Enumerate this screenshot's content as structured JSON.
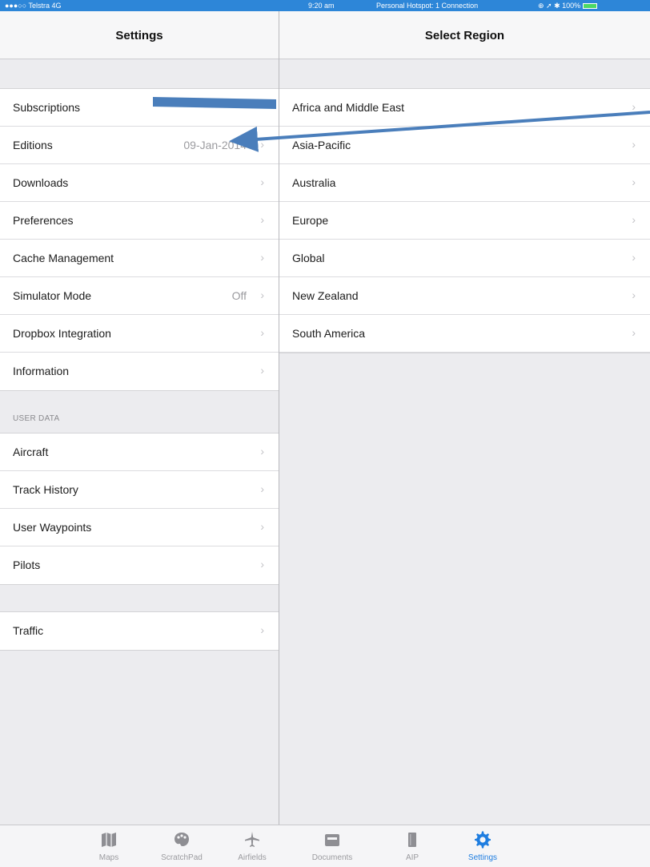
{
  "status_bar": {
    "carrier": "●●●○○ Telstra  4G",
    "time": "9:20 am",
    "hotspot": "Personal Hotspot: 1 Connection",
    "right": "⊕ ➚ ✱ 100%"
  },
  "left_nav": {
    "title": "Settings"
  },
  "right_nav": {
    "title": "Select Region"
  },
  "settings": {
    "items": [
      {
        "label": "Subscriptions",
        "value": "",
        "chevron": ""
      },
      {
        "label": "Editions",
        "value": "09-Jan-2014",
        "chevron": "›"
      },
      {
        "label": "Downloads",
        "value": "",
        "chevron": "›"
      },
      {
        "label": "Preferences",
        "value": "",
        "chevron": "›"
      },
      {
        "label": "Cache Management",
        "value": "",
        "chevron": "›"
      },
      {
        "label": "Simulator Mode",
        "value": "Off",
        "chevron": "›"
      },
      {
        "label": "Dropbox Integration",
        "value": "",
        "chevron": "›"
      },
      {
        "label": "Information",
        "value": "",
        "chevron": "›"
      }
    ],
    "user_data_header": "USER DATA",
    "user_data": [
      {
        "label": "Aircraft",
        "chevron": "›"
      },
      {
        "label": "Track History",
        "chevron": "›"
      },
      {
        "label": "User Waypoints",
        "chevron": "›"
      },
      {
        "label": "Pilots",
        "chevron": "›"
      }
    ],
    "traffic": {
      "label": "Traffic",
      "chevron": "›"
    }
  },
  "regions": [
    {
      "label": "Africa and Middle East",
      "chevron": "›"
    },
    {
      "label": "Asia-Pacific",
      "chevron": "›"
    },
    {
      "label": "Australia",
      "chevron": "›"
    },
    {
      "label": "Europe",
      "chevron": "›"
    },
    {
      "label": "Global",
      "chevron": "›"
    },
    {
      "label": "New Zealand",
      "chevron": "›"
    },
    {
      "label": "South America",
      "chevron": "›"
    }
  ],
  "tabs": [
    {
      "label": "Maps",
      "icon": "map-icon"
    },
    {
      "label": "ScratchPad",
      "icon": "palette-icon"
    },
    {
      "label": "Airfields",
      "icon": "airplane-icon"
    },
    {
      "label": "Documents",
      "icon": "folder-icon"
    },
    {
      "label": "AIP",
      "icon": "book-icon"
    },
    {
      "label": "Settings",
      "icon": "gear-icon",
      "active": true
    }
  ],
  "colors": {
    "accent": "#1e7de0",
    "status_bar": "#2d86d8",
    "annotation_arrow": "#4a7ebb"
  }
}
